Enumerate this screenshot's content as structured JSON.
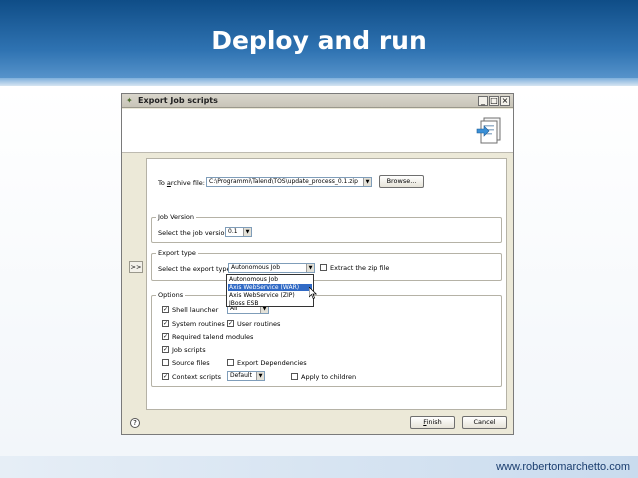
{
  "slide": {
    "title": "Deploy and run",
    "footer_url": "www.robertomarchetto.com"
  },
  "dialog": {
    "title": "Export Job scripts",
    "window_buttons": {
      "minimize": "_",
      "maximize": "□",
      "close": "×"
    },
    "archive": {
      "label_prefix": "To ",
      "label_u": "a",
      "label_suffix": "rchive file:",
      "path": "C:\\Programmi\\Talend\\TOS\\update_process_0.1.zip",
      "browse_label": "Browse..."
    },
    "job_version": {
      "group_title": "Job Version",
      "label": "Select the job version",
      "value": "0.1"
    },
    "export_type": {
      "group_title": "Export type",
      "label": "Select the export type",
      "value": "Autonomous Job",
      "extract_label": "Extract the zip file",
      "options": [
        "Autonomous Job",
        "Axis WebService (WAR)",
        "Axis WebService (ZIP)",
        "JBoss ESB"
      ],
      "highlighted_option": "Axis WebService (WAR)"
    },
    "options": {
      "group_title": "Options",
      "shell_launcher": "Shell launcher",
      "shell_value": "All",
      "system_routines": "System routines",
      "user_routines": "User routines",
      "required_modules": "Required talend modules",
      "job_scripts": "Job scripts",
      "source_files": "Source files",
      "export_dependencies": "Export Dependencies",
      "context_scripts": "Context scripts",
      "context_value": "Default",
      "apply_children": "Apply to children"
    },
    "collapse_label": ">>",
    "help_label": "?",
    "finish_label": "Finish",
    "cancel_label": "Cancel"
  }
}
